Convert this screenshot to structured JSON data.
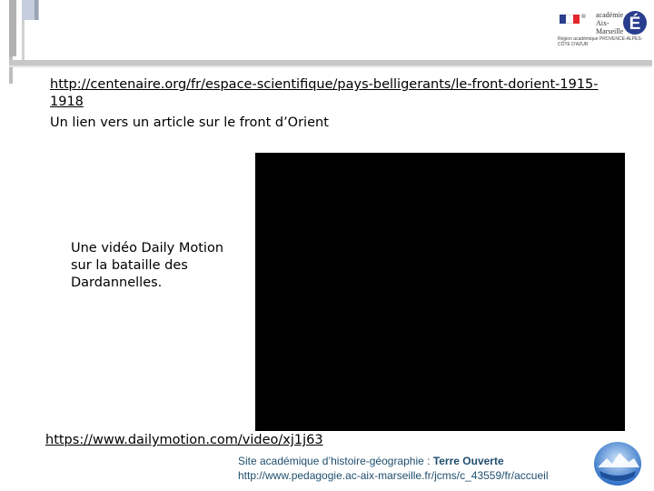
{
  "slide": {
    "link1_url": "http://centenaire.org/fr/espace-scientifique/pays-belligerants/le-front-dorient-1915-1918",
    "link1_description": "Un lien vers un article sur le front d’Orient",
    "video_description": "Une vidéo Daily Motion sur la bataille des Dardannelles.",
    "link2_url": "https://www.dailymotion.com/video/xj1j63"
  },
  "header": {
    "logo_academie": "académie Aix-Marseille",
    "logo_region": "Région académique PROVENCE-ALPES-CÔTE D'AZUR",
    "flag_colors": [
      "#2a3e8f",
      "#ffffff",
      "#e2262c"
    ]
  },
  "footer": {
    "site_prefix": "Site académique d’histoire-géographie : ",
    "site_name": "Terre Ouverte",
    "site_url": "http://www.pedagogie.ac-aix-marseille.fr/jcms/c_43559/fr/accueil"
  },
  "colors": {
    "footer_text": "#1f4e6e",
    "video_bg": "#000000"
  }
}
